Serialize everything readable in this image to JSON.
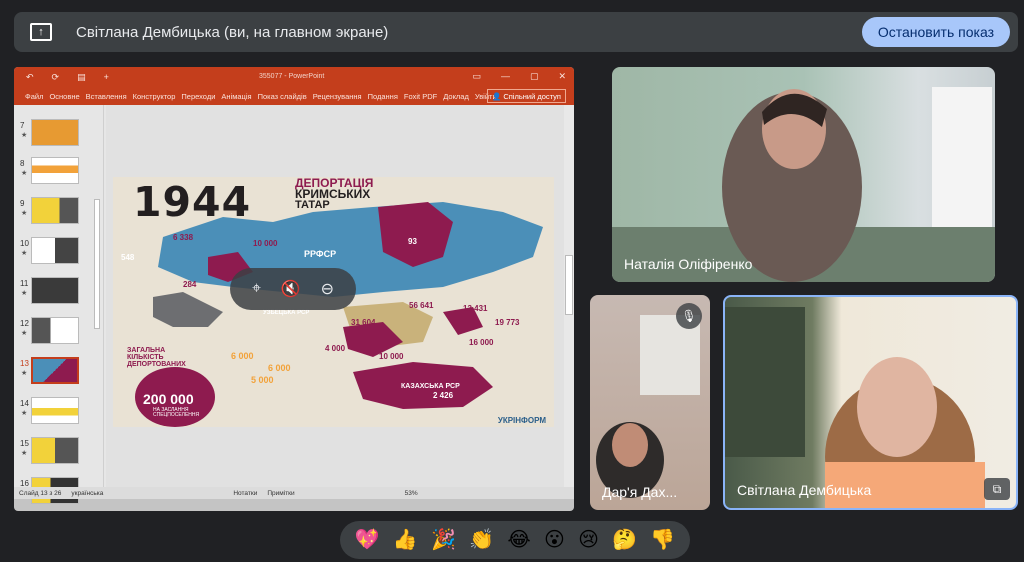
{
  "banner": {
    "title": "Світлана Дембицька (ви, на главном экране)",
    "stop_label": "Остановить показ",
    "icon": "present-screen-icon"
  },
  "ppt": {
    "doc_title": "355077 - PowerPoint",
    "quick_access": [
      "↶",
      "⟳",
      "▤",
      "+"
    ],
    "window_controls": [
      "▭",
      "—",
      "▢",
      "✕"
    ],
    "tabs": [
      "Файл",
      "Основне",
      "Вставлення",
      "Конструктор",
      "Переходи",
      "Анімація",
      "Показ слайдів",
      "Рецензування",
      "Подання",
      "Foxit PDF",
      "Доклад",
      "Увійти"
    ],
    "share_label": "Спільний доступ",
    "thumbnails": [
      {
        "num": "7",
        "active": false
      },
      {
        "num": "8",
        "active": false
      },
      {
        "num": "9",
        "active": false
      },
      {
        "num": "10",
        "active": false
      },
      {
        "num": "11",
        "active": false
      },
      {
        "num": "12",
        "active": false
      },
      {
        "num": "13",
        "active": true
      },
      {
        "num": "14",
        "active": false
      },
      {
        "num": "15",
        "active": false
      },
      {
        "num": "16",
        "active": false
      }
    ],
    "status": {
      "slide": "Слайд 13 з 26",
      "lang": "українська",
      "notes": "Нотатки",
      "comments": "Примітки",
      "zoom": "53%"
    },
    "slide": {
      "year": "1944",
      "head_l1": "ДЕПОРТАЦІЯ",
      "head_l2": "КРИМСЬКИХ",
      "head_l3": "ТАТАР",
      "rfsr": "РРФСР",
      "uzsr": "УЗБЕЦЬКА РСР",
      "kzsr": "КАЗАХСЬКА РСР",
      "n1": "6 338",
      "n2": "10 000",
      "n3": "548",
      "n4": "93",
      "n5": "284",
      "n6": "56 641",
      "n7": "13 431",
      "n8": "19 773",
      "n9": "31 604",
      "n10": "4 000",
      "n11": "10 000",
      "n12": "16 000",
      "n13": "2 426",
      "dep_title": "ЗАГАЛЬНА КІЛЬКІСТЬ ДЕПОРТОВАНИХ",
      "s1": "6 000",
      "s2": "6 000",
      "s3": "5 000",
      "big_num": "200 000",
      "big_sub": "НА ЗАСЛАННЯ СПЕЦПОСЕЛЕННЯ",
      "logo": "УКРІНФОРМ"
    }
  },
  "float_controls": [
    "pin-icon",
    "mute-icon",
    "remove-icon"
  ],
  "tiles": [
    {
      "name": "Наталія Оліфіренко"
    },
    {
      "name": "Дар'я Дах..."
    },
    {
      "name": "Світлана Дембицька"
    }
  ],
  "reactions": [
    "💖",
    "👍",
    "🎉",
    "👏",
    "😂",
    "😮",
    "😢",
    "🤔",
    "👎"
  ]
}
